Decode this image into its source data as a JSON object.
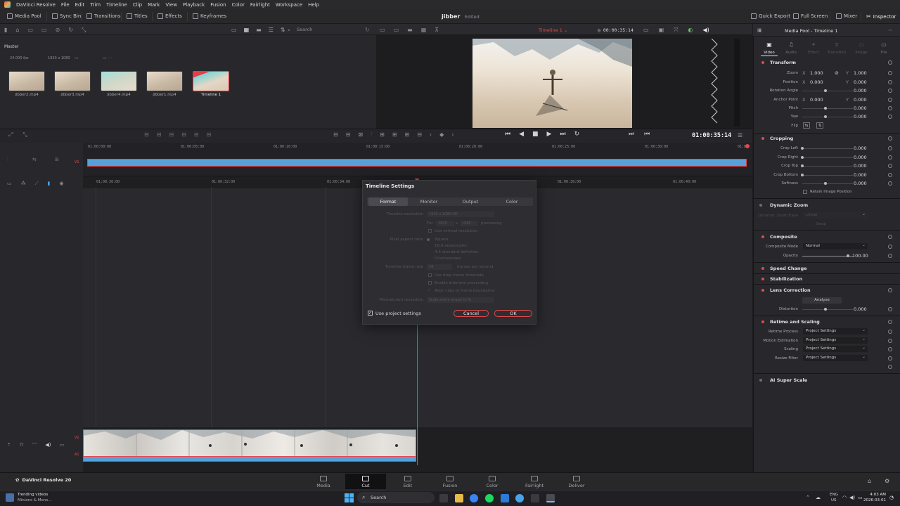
{
  "menubar": {
    "app": "DaVinci Resolve",
    "items": [
      "File",
      "Edit",
      "Trim",
      "Timeline",
      "Clip",
      "Mark",
      "View",
      "Playback",
      "Fusion",
      "Color",
      "Fairlight",
      "Workspace",
      "Help"
    ]
  },
  "toolbar": {
    "left": [
      "Media Pool",
      "Sync Bin",
      "Transitions",
      "Titles",
      "Effects",
      "Keyframes"
    ],
    "project": "jibber",
    "project_status": "Edited",
    "right": [
      "Quick Export",
      "Full Screen",
      "Mixer",
      "Inspector"
    ]
  },
  "media_pool": {
    "search_placeholder": "Search",
    "bin": "Master",
    "fps": "24.000 fps",
    "resolution": "1920 x 1080",
    "clips": [
      "jibber2.mp4",
      "jibber3.mp4",
      "jibber4.mp4",
      "jibber1.mp4",
      "Timeline 1"
    ]
  },
  "viewer": {
    "timeline_name": "Timeline 1",
    "timecode_top": "00:00:35:14",
    "timecode_main": "01:00:35:14"
  },
  "ruler_upper": [
    "01:00:00:00",
    "01:00:05:00",
    "01:00:10:00",
    "01:00:15:00",
    "01:00:20:00",
    "01:00:25:00",
    "01:00:30:00",
    "01:0"
  ],
  "ruler_lower": [
    "01:00:30:00",
    "01:00:32:00",
    "01:00:34:00",
    "01:00:38:00",
    "01:00:40:00"
  ],
  "track_labels": {
    "v1": "V1",
    "a1": "A1"
  },
  "inspector": {
    "header": "Media Pool - Timeline 1",
    "tabs": [
      "Video",
      "Audio",
      "Effect",
      "Transition",
      "Image",
      "File"
    ],
    "transform": {
      "title": "Transform",
      "zoom_label": "Zoom",
      "zoom_x": "1.000",
      "zoom_y": "1.000",
      "position_label": "Position",
      "position_x": "0.000",
      "position_y": "0.000",
      "rotation_label": "Rotation Angle",
      "rotation": "0.000",
      "anchor_label": "Anchor Point",
      "anchor_x": "0.000",
      "anchor_y": "0.000",
      "pitch_label": "Pitch",
      "pitch": "0.000",
      "yaw_label": "Yaw",
      "yaw": "0.000",
      "flip_label": "Flip",
      "x": "X",
      "y": "Y"
    },
    "cropping": {
      "title": "Cropping",
      "left_label": "Crop Left",
      "left": "0.000",
      "right_label": "Crop Right",
      "right": "0.000",
      "top_label": "Crop Top",
      "top": "0.000",
      "bottom_label": "Crop Bottom",
      "bottom": "0.000",
      "softness_label": "Softness",
      "softness": "0.000",
      "retain": "Retain Image Position"
    },
    "dynamic_zoom": {
      "title": "Dynamic Zoom",
      "ease_label": "Dynamic Zoom Ease",
      "ease": "Linear",
      "swap": "Swap"
    },
    "composite": {
      "title": "Composite",
      "mode_label": "Composite Mode",
      "mode": "Normal",
      "opacity_label": "Opacity",
      "opacity": "100.00"
    },
    "speed_change": "Speed Change",
    "stabilization": "Stabilization",
    "lens": {
      "title": "Lens Correction",
      "analyze": "Analyze",
      "distortion_label": "Distortion",
      "distortion": "0.000"
    },
    "retime": {
      "title": "Retime and Scaling",
      "process_label": "Retime Process",
      "process": "Project Settings",
      "motion_label": "Motion Estimation",
      "motion": "Project Settings",
      "scaling_label": "Scaling",
      "scaling": "Project Settings",
      "resize_label": "Resize Filter",
      "resize": "Project Settings"
    },
    "ai_super_scale": "AI Super Scale"
  },
  "dialog": {
    "title": "Timeline Settings",
    "tabs": [
      "Format",
      "Monitor",
      "Output",
      "Color"
    ],
    "resolution_label": "Timeline resolution",
    "resolution": "1920 x 1080 HD",
    "for": "For",
    "width": "1920",
    "x": "x",
    "height": "1080",
    "processing": "processing",
    "vertical": "Use vertical resolution",
    "par_label": "Pixel aspect ratio",
    "par_options": [
      "Square",
      "16:9 anamorphic",
      "4:3 standard definition",
      "Cinemascope"
    ],
    "fps_label": "Timeline frame rate",
    "fps": "24",
    "fps_unit": "frames per second",
    "drop_frame": "Use drop frame timecode",
    "interlace": "Enable interlace processing",
    "align": "Align clips to frame boundaries",
    "mismatch_label": "Mismatched resolution",
    "mismatch": "Scale entire image to fit",
    "use_project": "Use project settings",
    "cancel": "Cancel",
    "ok": "OK"
  },
  "pages": [
    "Media",
    "Cut",
    "Edit",
    "Fusion",
    "Color",
    "Fairlight",
    "Deliver"
  ],
  "brand": "DaVinci Resolve 20",
  "taskbar": {
    "news_title": "Trending videos",
    "news_sub": "Minions & Mons...",
    "search": "Search",
    "lang": "ENG",
    "region": "US",
    "time": "4:03 AM",
    "date": "2026-03-01"
  }
}
